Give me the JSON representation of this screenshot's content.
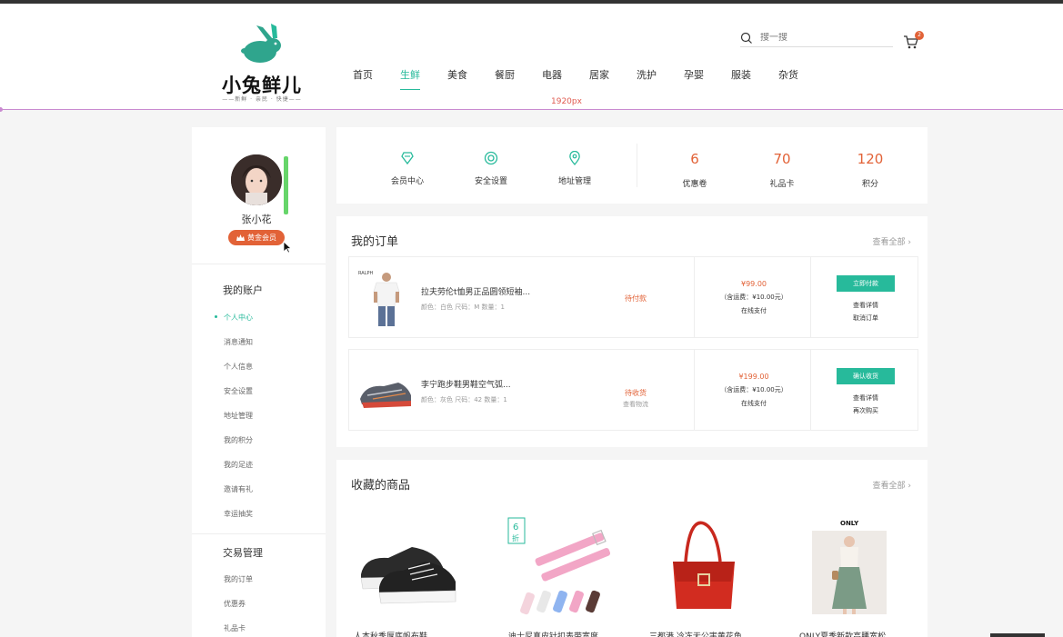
{
  "header": {
    "brand": "小兔鲜儿",
    "tagline": "——新鲜 · 亲民 · 快捷——",
    "width_tag": "1920px",
    "nav": [
      "首页",
      "生鲜",
      "美食",
      "餐厨",
      "电器",
      "居家",
      "洗护",
      "孕婴",
      "服装",
      "杂货"
    ],
    "active_nav": "生鲜",
    "search_placeholder": "搜一搜",
    "cart_count": "2"
  },
  "sidebar": {
    "username": "张小花",
    "member_level": "黄金会员",
    "groups": [
      {
        "title": "我的账户",
        "items": [
          "个人中心",
          "消息通知",
          "个人信息",
          "安全设置",
          "地址管理",
          "我的积分",
          "我的足迹",
          "邀请有礼",
          "幸运抽奖"
        ]
      },
      {
        "title": "交易管理",
        "items": [
          "我的订单",
          "优惠券",
          "礼品卡"
        ]
      }
    ],
    "active_item": "个人中心"
  },
  "overview": {
    "links": [
      {
        "label": "会员中心",
        "icon": "member-icon"
      },
      {
        "label": "安全设置",
        "icon": "security-icon"
      },
      {
        "label": "地址管理",
        "icon": "location-icon"
      }
    ],
    "stats": [
      {
        "value": "6",
        "label": "优惠卷"
      },
      {
        "value": "70",
        "label": "礼品卡"
      },
      {
        "value": "120",
        "label": "积分"
      }
    ]
  },
  "orders": {
    "title": "我的订单",
    "more": "查看全部 ›",
    "items": [
      {
        "name": "拉夫劳伦t恤男正品圆领短袖...",
        "spec": "颜色：白色   尺码：M   数量：1",
        "status": "待付款",
        "status_sub": "",
        "price": "¥99.00",
        "freight": "（含运费：¥10.00元）",
        "pay_method": "在线支付",
        "button": "立即付款",
        "actions": [
          "查看详情",
          "取消订单"
        ]
      },
      {
        "name": "李宁跑步鞋男鞋空气弧...",
        "spec": "颜色：灰色   尺码：42   数量：1",
        "status": "待收货",
        "status_sub": "查看物流",
        "price": "¥199.00",
        "freight": "（含运费：¥10.00元）",
        "pay_method": "在线支付",
        "button": "确认收货",
        "actions": [
          "查看详情",
          "再次购买"
        ]
      }
    ]
  },
  "favorites": {
    "title": "收藏的商品",
    "more": "查看全部 ›",
    "discount_tag_num": "6",
    "discount_tag_text": "折",
    "brand_label": "ONLY",
    "items": [
      {
        "name": "人本秋季厚底帆布鞋"
      },
      {
        "name": "迪士尼真皮针扣表带宽度"
      },
      {
        "name": "三都港 冷冻无公害黄花鱼"
      },
      {
        "name": "ONLY夏季新款高腰宽松"
      }
    ]
  },
  "colors": {
    "accent": "#27ba9b",
    "highlight": "#e26237"
  }
}
